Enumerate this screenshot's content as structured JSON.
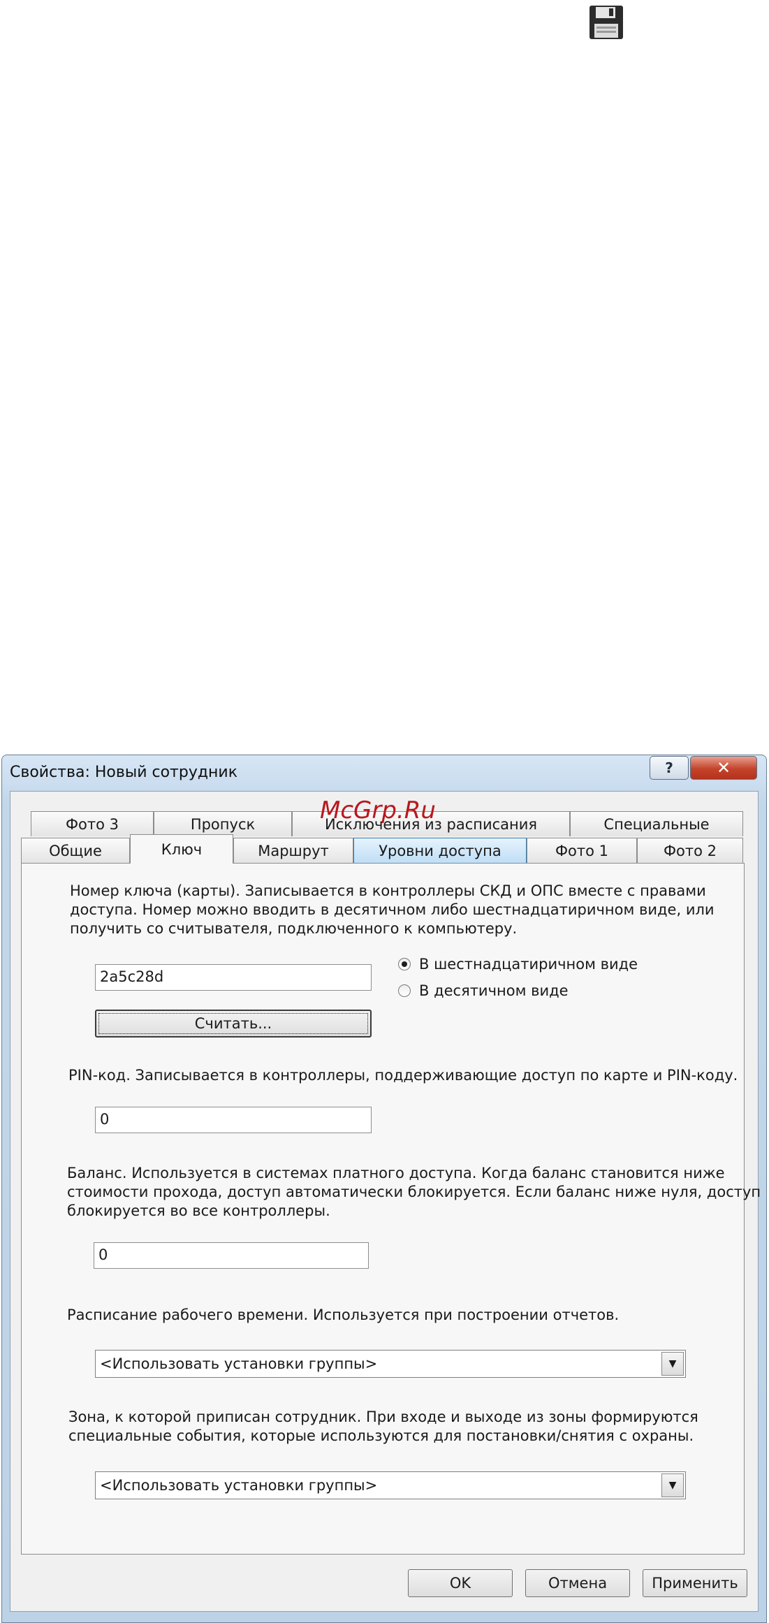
{
  "dialog": {
    "title": "Свойства: Новый сотрудник",
    "help_label": "?",
    "close_label": "✕"
  },
  "watermark": "McGrp.Ru",
  "tabs_row1": [
    "Фото 3",
    "Пропуск",
    "Исключения из расписания",
    "Специальные"
  ],
  "tabs_row2": [
    "Общие",
    "Ключ",
    "Маршрут",
    "Уровни доступа",
    "Фото 1",
    "Фото 2"
  ],
  "key": {
    "description": [
      "Номер ключа (карты). Записывается в контроллеры СКД и ОПС вместе с правами",
      "доступа. Номер можно вводить в десятичном либо шестнадцатиричном виде, или",
      "получить со считывателя, подключенного к компьютеру."
    ],
    "value": "2a5c28d",
    "radio_hex": "В шестнадцатиричном виде",
    "radio_dec": "В десятичном виде",
    "read_button": "Считать..."
  },
  "pin": {
    "description": "PIN-код. Записывается в контроллеры, поддерживающие доступ по карте и PIN-коду.",
    "value": "0"
  },
  "balance": {
    "description": [
      "Баланс. Используется в системах платного доступа. Когда баланс становится ниже",
      "стоимости прохода, доступ автоматически блокируется. Если баланс ниже нуля, доступ",
      "блокируется во все контроллеры."
    ],
    "value": "0"
  },
  "schedule": {
    "description": "Расписание рабочего времени. Используется при построении отчетов.",
    "selected": "<Использовать установки группы>"
  },
  "zone": {
    "description": [
      "Зона, к которой приписан сотрудник. При входе и выходе из зоны формируются",
      "специальные события, которые используются для постановки/снятия с охраны."
    ],
    "selected": "<Использовать установки группы>"
  },
  "footer": {
    "ok": "OK",
    "cancel": "Отмена",
    "apply": "Применить"
  },
  "icons": {
    "top": "floppy-disk-icon",
    "dropdown": "chevron-down-icon"
  }
}
